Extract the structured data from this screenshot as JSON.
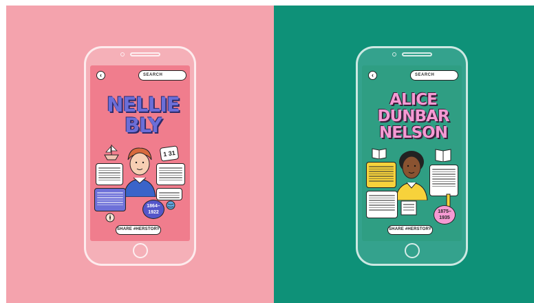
{
  "left_phone": {
    "search_placeholder": "SEARCH",
    "back_label": "‹",
    "title": "NELLIE BLY",
    "calendar": "1 31",
    "dates": "1864–1922",
    "share_label": "SHARE #HERSTORY",
    "screen_color": "#f07d8d",
    "accent_color": "#6b6ed8"
  },
  "right_phone": {
    "search_placeholder": "SEARCH",
    "back_label": "‹",
    "title": "ALICE DUNBAR NELSON",
    "dates": "1875–1935",
    "share_label": "SHARE #HERSTORY",
    "screen_color": "#2f9e83",
    "accent_color": "#f59ad3"
  },
  "colors": {
    "left_background": "#f4a3ad",
    "right_background": "#0e9178"
  }
}
